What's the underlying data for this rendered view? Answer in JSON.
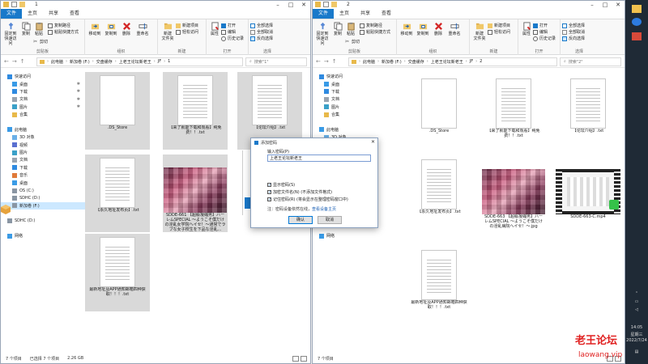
{
  "colors": {
    "file_tab": "#1979ca",
    "selection": "#cce8ff",
    "taskbar": "#1f2a36",
    "accent": "#0078d7",
    "watermark": "#e02020"
  },
  "left": {
    "title": "1",
    "tabs": [
      "文件",
      "主页",
      "共享",
      "查看"
    ],
    "ribbon": {
      "clipboard": {
        "pin_label": "固定到快速访问",
        "copy_label": "复制",
        "paste_label": "粘贴",
        "copy_path": "复制路径",
        "paste_shortcut": "粘贴快捷方式",
        "cut": "剪切",
        "group": "剪贴板"
      },
      "organize": {
        "move_to": "移动到",
        "copy_to": "复制到",
        "delete": "删除",
        "rename": "重命名",
        "group": "组织"
      },
      "new": {
        "new_folder": "新建\n文件夹",
        "new_item": "新建项目",
        "easy_access": "轻松访问",
        "group": "新建"
      },
      "open": {
        "properties": "属性",
        "open": "打开",
        "edit": "编辑",
        "history": "历史记录",
        "group": "打开"
      },
      "select": {
        "select_all": "全部选择",
        "select_none": "全部取消",
        "invert": "反向选择",
        "group": "选择"
      }
    },
    "crumbs": [
      "此电脑",
      "新加卷 (F:)",
      "交盘缓存",
      "上老王论坛新老王",
      "JF",
      "1"
    ],
    "search_placeholder": "搜索\"1\"",
    "nav": [
      {
        "label": "快速访问",
        "icon": "star-icon",
        "pin": ""
      },
      {
        "label": "桌面",
        "icon": "desktop-icon",
        "pin": "✱"
      },
      {
        "label": "下载",
        "icon": "download-icon",
        "pin": "✱"
      },
      {
        "label": "文档",
        "icon": "document-icon",
        "pin": "✱"
      },
      {
        "label": "图片",
        "icon": "picture-icon",
        "pin": "✱"
      },
      {
        "label": "合集",
        "icon": "folder-icon",
        "pin": ""
      },
      {
        "label": "",
        "icon": "",
        "pin": ""
      },
      {
        "label": "此电脑",
        "icon": "computer-icon",
        "pin": ""
      },
      {
        "label": "3D 对象",
        "icon": "cube-icon",
        "pin": ""
      },
      {
        "label": "视频",
        "icon": "video-icon",
        "pin": ""
      },
      {
        "label": "图片",
        "icon": "picture-icon",
        "pin": ""
      },
      {
        "label": "文档",
        "icon": "document-icon",
        "pin": ""
      },
      {
        "label": "下载",
        "icon": "download-icon",
        "pin": ""
      },
      {
        "label": "音乐",
        "icon": "music-icon",
        "pin": ""
      },
      {
        "label": "桌面",
        "icon": "desktop-icon",
        "pin": ""
      },
      {
        "label": "OS (C:)",
        "icon": "drive-icon",
        "pin": ""
      },
      {
        "label": "SDHC (D:)",
        "icon": "drive-icon",
        "pin": ""
      },
      {
        "label": "新加卷 (F:)",
        "icon": "drive-icon",
        "pin": ""
      },
      {
        "label": "",
        "icon": "",
        "pin": ""
      },
      {
        "label": "SDHC (D:)",
        "icon": "drive-icon",
        "pin": ""
      },
      {
        "label": "",
        "icon": "",
        "pin": ""
      },
      {
        "label": "网络",
        "icon": "network-icon",
        "pin": ""
      }
    ],
    "files": [
      {
        "name": ".DS_Store",
        "kind": "doc"
      },
      {
        "name": "【来了就能下载和观看】纯免费！！.txt",
        "kind": "doc"
      },
      {
        "name": "【论坛介绍】.txt",
        "kind": "doc"
      },
      {
        "name": "【永久地址发布页】.txt",
        "kind": "doc"
      },
      {
        "name": "SDDE-661 【超級凝縮男】ハーレムSPECIAL ～ようこそ僕だけの淫乱女学院ヘイセ！～通常でラブな女子校生を下品な淫乱...",
        "kind": "img"
      },
      {
        "name": "最新地址及APP通知邮箱四种获取！！！.txt",
        "kind": "doc"
      }
    ],
    "status": {
      "count": "7 个项目",
      "selected": "已选择 7 个项目",
      "size": "2.26 GB"
    }
  },
  "right": {
    "title": "2",
    "tabs": [
      "文件",
      "主页",
      "共享",
      "查看"
    ],
    "crumbs": [
      "此电脑",
      "新加卷 (F:)",
      "交盘缓存",
      "上老王论坛新老王",
      "JF",
      "2"
    ],
    "search_placeholder": "搜索\"2\"",
    "nav": [
      {
        "label": "快速访问",
        "icon": "star-icon",
        "pin": ""
      },
      {
        "label": "桌面",
        "icon": "desktop-icon",
        "pin": ""
      },
      {
        "label": "下载",
        "icon": "download-icon",
        "pin": ""
      },
      {
        "label": "文档",
        "icon": "document-icon",
        "pin": ""
      },
      {
        "label": "图片",
        "icon": "picture-icon",
        "pin": ""
      },
      {
        "label": "合集",
        "icon": "folder-icon",
        "pin": ""
      },
      {
        "label": "",
        "icon": "",
        "pin": ""
      },
      {
        "label": "此电脑",
        "icon": "computer-icon",
        "pin": ""
      },
      {
        "label": "3D 对象",
        "icon": "cube-icon",
        "pin": ""
      },
      {
        "label": "视频",
        "icon": "video-icon",
        "pin": ""
      },
      {
        "label": "图片",
        "icon": "picture-icon",
        "pin": ""
      },
      {
        "label": "文档",
        "icon": "document-icon",
        "pin": ""
      },
      {
        "label": "下载",
        "icon": "download-icon",
        "pin": ""
      },
      {
        "label": "音乐",
        "icon": "music-icon",
        "pin": ""
      },
      {
        "label": "桌面",
        "icon": "desktop-icon",
        "pin": ""
      },
      {
        "label": "OS (C:)",
        "icon": "drive-icon",
        "pin": ""
      },
      {
        "label": "SDHC (D:)",
        "icon": "drive-icon",
        "pin": ""
      },
      {
        "label": "新加卷 (F:)",
        "icon": "drive-icon",
        "pin": ""
      },
      {
        "label": "",
        "icon": "",
        "pin": ""
      },
      {
        "label": "SDHC (D:)",
        "icon": "drive-icon",
        "pin": ""
      },
      {
        "label": "",
        "icon": "",
        "pin": ""
      },
      {
        "label": "网络",
        "icon": "network-icon",
        "pin": ""
      }
    ],
    "files": [
      {
        "name": ".DS_Store",
        "kind": "doc"
      },
      {
        "name": "【来了就能下载和观看】纯免费！！.txt",
        "kind": "doc"
      },
      {
        "name": "【论坛介绍】.txt",
        "kind": "doc"
      },
      {
        "name": "【永久地址发布页】.txt",
        "kind": "doc"
      },
      {
        "name": "SDDE-663 【超級凝縮男】ハーレムSPECIAL ～ようこそ僕だけの淫乱病院へイセ！～.jpg",
        "kind": "img"
      },
      {
        "name": "SDDE-663-C.mp4",
        "kind": "vid"
      },
      {
        "name": "最新地址及APP通知邮箱四种获取！！！.txt",
        "kind": "doc"
      }
    ],
    "status": {
      "count": "7 个项目",
      "selected": "",
      "size": ""
    }
  },
  "dialog": {
    "title": "添加密码",
    "label": "输入密码(P)",
    "value": "上老王论坛新老王",
    "opt1": "显示密码(S)",
    "opt2": "加密文件名(N) (不添加文件格式)",
    "opt3": "记住密码(R) (将会显示在整理密码窗口中)",
    "note": "注：密码设备依然在线，",
    "note_link": "查看设备主页",
    "ok": "确认",
    "cancel": "取消"
  },
  "taskbar": {
    "time": "14:05",
    "day": "星期三",
    "date": "2022/7/24"
  },
  "watermark": {
    "line1": "老王论坛",
    "line2": "laowang.vip"
  }
}
